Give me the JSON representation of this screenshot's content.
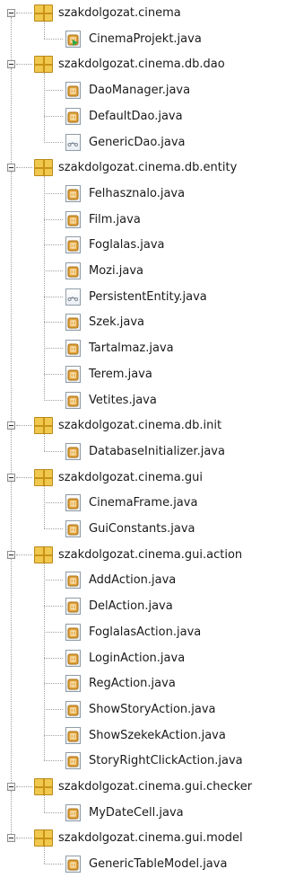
{
  "tree": {
    "rows": [
      {
        "type": "package",
        "label": "szakdolgozat.cinema"
      },
      {
        "type": "file",
        "label": "CinemaProjekt.java",
        "icon": "main-class-icon",
        "last": true
      },
      {
        "type": "package",
        "label": "szakdolgozat.cinema.db.dao"
      },
      {
        "type": "file",
        "label": "DaoManager.java",
        "icon": "class-icon"
      },
      {
        "type": "file",
        "label": "DefaultDao.java",
        "icon": "class-icon"
      },
      {
        "type": "file",
        "label": "GenericDao.java",
        "icon": "interface-icon",
        "last": true
      },
      {
        "type": "package",
        "label": "szakdolgozat.cinema.db.entity"
      },
      {
        "type": "file",
        "label": "Felhasznalo.java",
        "icon": "class-icon"
      },
      {
        "type": "file",
        "label": "Film.java",
        "icon": "class-icon"
      },
      {
        "type": "file",
        "label": "Foglalas.java",
        "icon": "class-icon"
      },
      {
        "type": "file",
        "label": "Mozi.java",
        "icon": "class-icon"
      },
      {
        "type": "file",
        "label": "PersistentEntity.java",
        "icon": "interface-icon"
      },
      {
        "type": "file",
        "label": "Szek.java",
        "icon": "class-icon"
      },
      {
        "type": "file",
        "label": "Tartalmaz.java",
        "icon": "class-icon"
      },
      {
        "type": "file",
        "label": "Terem.java",
        "icon": "class-icon"
      },
      {
        "type": "file",
        "label": "Vetites.java",
        "icon": "class-icon",
        "last": true
      },
      {
        "type": "package",
        "label": "szakdolgozat.cinema.db.init"
      },
      {
        "type": "file",
        "label": "DatabaseInitializer.java",
        "icon": "class-icon",
        "last": true
      },
      {
        "type": "package",
        "label": "szakdolgozat.cinema.gui"
      },
      {
        "type": "file",
        "label": "CinemaFrame.java",
        "icon": "class-icon"
      },
      {
        "type": "file",
        "label": "GuiConstants.java",
        "icon": "class-icon",
        "last": true
      },
      {
        "type": "package",
        "label": "szakdolgozat.cinema.gui.action"
      },
      {
        "type": "file",
        "label": "AddAction.java",
        "icon": "class-icon"
      },
      {
        "type": "file",
        "label": "DelAction.java",
        "icon": "class-icon"
      },
      {
        "type": "file",
        "label": "FoglalasAction.java",
        "icon": "class-icon"
      },
      {
        "type": "file",
        "label": "LoginAction.java",
        "icon": "class-icon"
      },
      {
        "type": "file",
        "label": "RegAction.java",
        "icon": "class-icon"
      },
      {
        "type": "file",
        "label": "ShowStoryAction.java",
        "icon": "class-icon"
      },
      {
        "type": "file",
        "label": "ShowSzekekAction.java",
        "icon": "class-icon"
      },
      {
        "type": "file",
        "label": "StoryRightClickAction.java",
        "icon": "class-icon",
        "last": true
      },
      {
        "type": "package",
        "label": "szakdolgozat.cinema.gui.checker"
      },
      {
        "type": "file",
        "label": "MyDateCell.java",
        "icon": "class-icon",
        "last": true
      },
      {
        "type": "package",
        "label": "szakdolgozat.cinema.gui.model"
      },
      {
        "type": "file",
        "label": "GenericTableModel.java",
        "icon": "class-icon",
        "last": true
      }
    ]
  },
  "colors": {
    "package_fill": "#f1c84e",
    "package_border": "#b98a1a",
    "class_badge": "#e2a33c",
    "main_arrow": "#2fa84b",
    "interface_line": "#7a8894",
    "tree_line": "#a0a0a0"
  }
}
